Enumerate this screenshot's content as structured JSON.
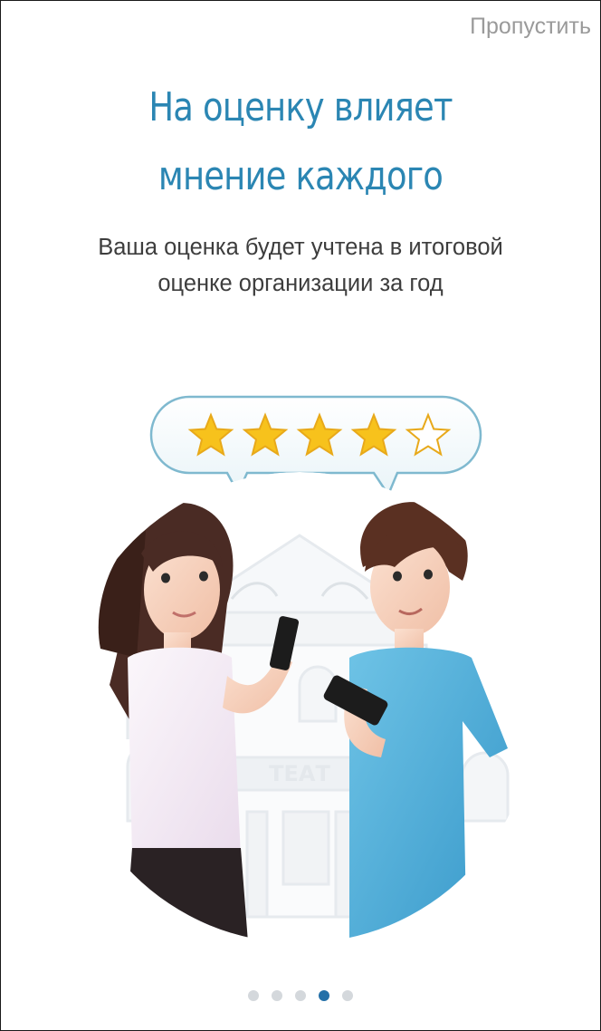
{
  "header": {
    "skip_label": "Пропустить"
  },
  "main": {
    "title_line1": "На оценку влияет",
    "title_line2": "мнение каждого",
    "subtitle_line1": "Ваша оценка будет учтена в итоговой",
    "subtitle_line2": "оценке организации за год"
  },
  "illustration": {
    "theater_sign": "ТЕАТ",
    "rating": 4,
    "rating_max": 5,
    "icon": "people-rating-theater-illustration"
  },
  "pager": {
    "pages": 5,
    "active_index": 3
  },
  "colors": {
    "title": "#2b86b3",
    "skip": "#9a9a9a",
    "subtitle": "#3d3d3d",
    "dot_inactive": "#d4d8dc",
    "dot_active": "#2470a8",
    "star_fill": "#f7c21c"
  }
}
